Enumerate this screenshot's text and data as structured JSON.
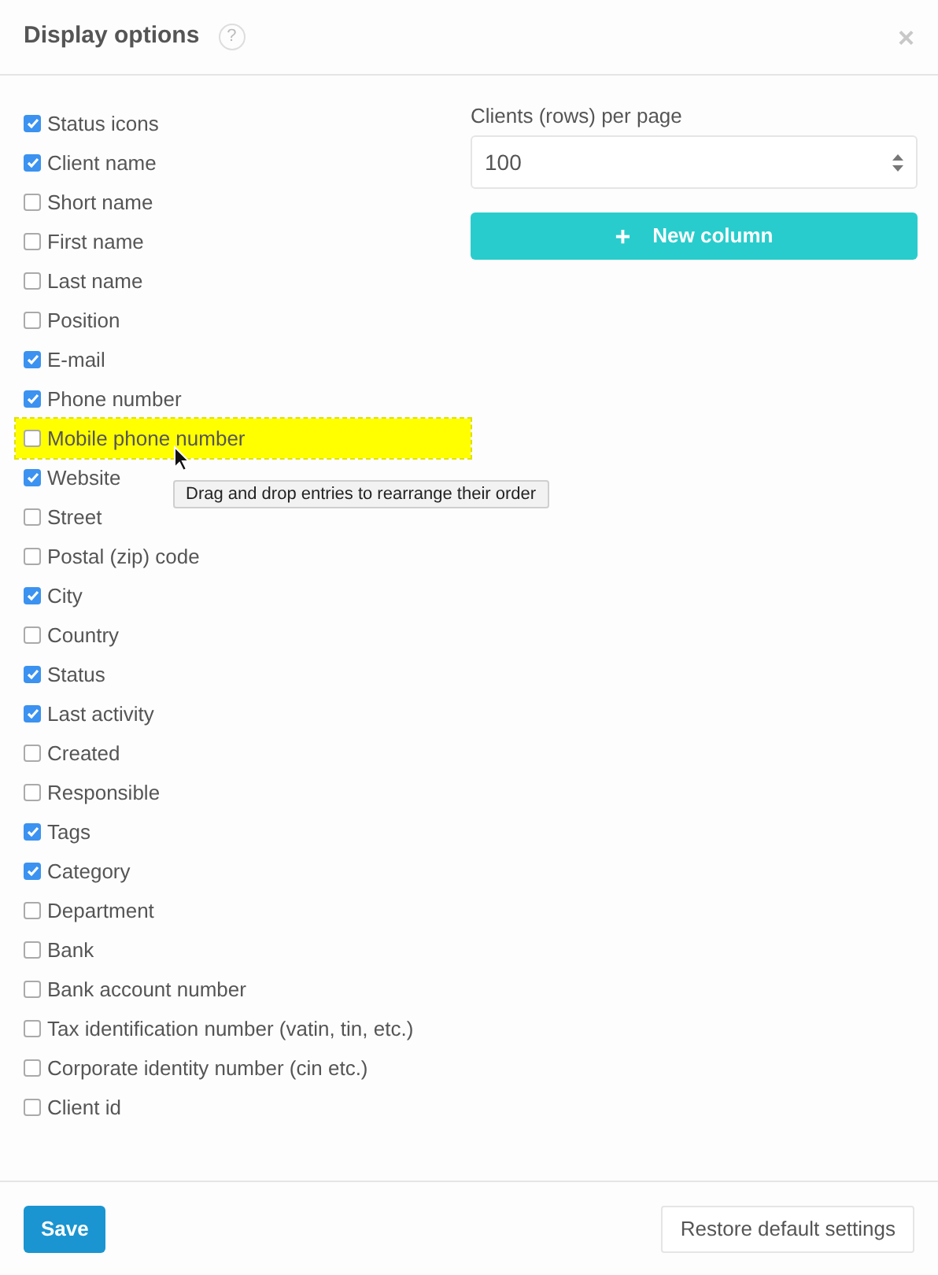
{
  "dialog": {
    "title": "Display options",
    "help": "?",
    "close": "×"
  },
  "columns": [
    {
      "label": "Status icons",
      "checked": true,
      "highlighted": false
    },
    {
      "label": "Client name",
      "checked": true,
      "highlighted": false
    },
    {
      "label": "Short name",
      "checked": false,
      "highlighted": false
    },
    {
      "label": "First name",
      "checked": false,
      "highlighted": false
    },
    {
      "label": "Last name",
      "checked": false,
      "highlighted": false
    },
    {
      "label": "Position",
      "checked": false,
      "highlighted": false
    },
    {
      "label": "E-mail",
      "checked": true,
      "highlighted": false
    },
    {
      "label": "Phone number",
      "checked": true,
      "highlighted": false
    },
    {
      "label": "Mobile phone number",
      "checked": false,
      "highlighted": true
    },
    {
      "label": "Website",
      "checked": true,
      "highlighted": false
    },
    {
      "label": "Street",
      "checked": false,
      "highlighted": false
    },
    {
      "label": "Postal (zip) code",
      "checked": false,
      "highlighted": false
    },
    {
      "label": "City",
      "checked": true,
      "highlighted": false
    },
    {
      "label": "Country",
      "checked": false,
      "highlighted": false
    },
    {
      "label": "Status",
      "checked": true,
      "highlighted": false
    },
    {
      "label": "Last activity",
      "checked": true,
      "highlighted": false
    },
    {
      "label": "Created",
      "checked": false,
      "highlighted": false
    },
    {
      "label": "Responsible",
      "checked": false,
      "highlighted": false
    },
    {
      "label": "Tags",
      "checked": true,
      "highlighted": false
    },
    {
      "label": "Category",
      "checked": true,
      "highlighted": false
    },
    {
      "label": "Department",
      "checked": false,
      "highlighted": false
    },
    {
      "label": "Bank",
      "checked": false,
      "highlighted": false
    },
    {
      "label": "Bank account number",
      "checked": false,
      "highlighted": false
    },
    {
      "label": "Tax identification number (vatin, tin, etc.)",
      "checked": false,
      "highlighted": false
    },
    {
      "label": "Corporate identity number (cin etc.)",
      "checked": false,
      "highlighted": false
    },
    {
      "label": "Client id",
      "checked": false,
      "highlighted": false
    }
  ],
  "tooltip": "Drag and drop entries to rearrange their order",
  "rows_per_page": {
    "label": "Clients (rows) per page",
    "value": "100"
  },
  "new_column_button": {
    "icon": "+",
    "label": "New column"
  },
  "footer": {
    "save": "Save",
    "restore": "Restore default settings"
  }
}
